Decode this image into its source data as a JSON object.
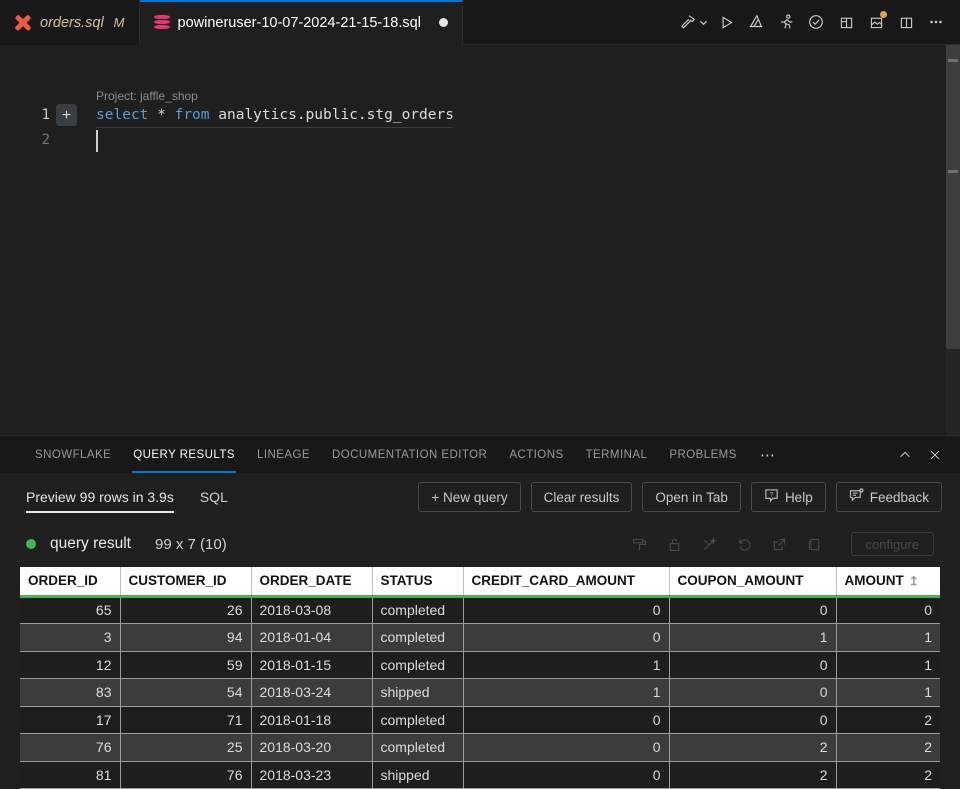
{
  "tabs": [
    {
      "label": "orders.sql",
      "modifier": "M",
      "icon": "dbt-icon",
      "active": false,
      "dirty": false
    },
    {
      "label": "powineruser",
      "icon": "database-icon",
      "active": true,
      "dirty": true
    }
  ],
  "editor_tabs": {
    "inactive": {
      "label": "orders.sql",
      "modifier": "M"
    },
    "active": {
      "label": "powineruser-10-07-2024-21-15-18.sql"
    }
  },
  "toolbar": {
    "icons": [
      "hammer-icon",
      "chevron-down-icon",
      "play-icon",
      "lineage-icon",
      "run-person-icon",
      "check-circle-icon",
      "split-panel-icon",
      "preview-image-icon",
      "split-editor-icon",
      "more-actions-icon"
    ]
  },
  "editor": {
    "codelens": "Project: jaffle_shop",
    "lines": [
      {
        "number": "1",
        "keyword1": "select",
        "operator": "*",
        "keyword2": "from",
        "identifier": "analytics.public.stg_orders"
      },
      {
        "number": "2"
      }
    ],
    "add_button": "+"
  },
  "panel": {
    "tabs": [
      {
        "label": "SNOWFLAKE",
        "active": false
      },
      {
        "label": "QUERY RESULTS",
        "active": true
      },
      {
        "label": "LINEAGE",
        "active": false
      },
      {
        "label": "DOCUMENTATION EDITOR",
        "active": false
      },
      {
        "label": "ACTIONS",
        "active": false
      },
      {
        "label": "TERMINAL",
        "active": false
      },
      {
        "label": "PROBLEMS",
        "active": false
      }
    ],
    "more": "⋯",
    "collapse_icon": "chevron-up-icon",
    "close_icon": "close-icon"
  },
  "results": {
    "subtabs": [
      {
        "label": "Preview 99 rows in 3.9s",
        "active": true
      },
      {
        "label": "SQL",
        "active": false
      }
    ],
    "buttons": [
      {
        "label": "+ New query",
        "icon": null
      },
      {
        "label": "Clear results",
        "icon": null
      },
      {
        "label": "Open in Tab",
        "icon": null
      },
      {
        "label": "Help",
        "icon": "help-icon"
      },
      {
        "label": "Feedback",
        "icon": "feedback-icon"
      }
    ],
    "status_color": "#3fb950",
    "title": "query result",
    "dimensions": "99 x 7 (10)",
    "meta_icons": [
      "paint-roller-icon",
      "unlock-icon",
      "magic-wand-icon",
      "reset-icon",
      "open-external-icon",
      "copy-icon"
    ],
    "configure_label": "configure"
  },
  "table": {
    "columns": [
      {
        "name": "ORDER_ID",
        "sorted": false
      },
      {
        "name": "CUSTOMER_ID",
        "sorted": false
      },
      {
        "name": "ORDER_DATE",
        "sorted": false
      },
      {
        "name": "STATUS",
        "sorted": false
      },
      {
        "name": "CREDIT_CARD_AMOUNT",
        "sorted": false
      },
      {
        "name": "COUPON_AMOUNT",
        "sorted": false
      },
      {
        "name": "AMOUNT",
        "sorted": true,
        "sort_icon": "↥"
      }
    ],
    "rows": [
      [
        "65",
        "26",
        "2018-03-08",
        "completed",
        "0",
        "0",
        "0"
      ],
      [
        "3",
        "94",
        "2018-01-04",
        "completed",
        "0",
        "1",
        "1"
      ],
      [
        "12",
        "59",
        "2018-01-15",
        "completed",
        "1",
        "0",
        "1"
      ],
      [
        "83",
        "54",
        "2018-03-24",
        "shipped",
        "1",
        "0",
        "1"
      ],
      [
        "17",
        "71",
        "2018-01-18",
        "completed",
        "0",
        "0",
        "2"
      ],
      [
        "76",
        "25",
        "2018-03-20",
        "completed",
        "0",
        "2",
        "2"
      ],
      [
        "81",
        "76",
        "2018-03-23",
        "shipped",
        "0",
        "2",
        "2"
      ]
    ]
  }
}
